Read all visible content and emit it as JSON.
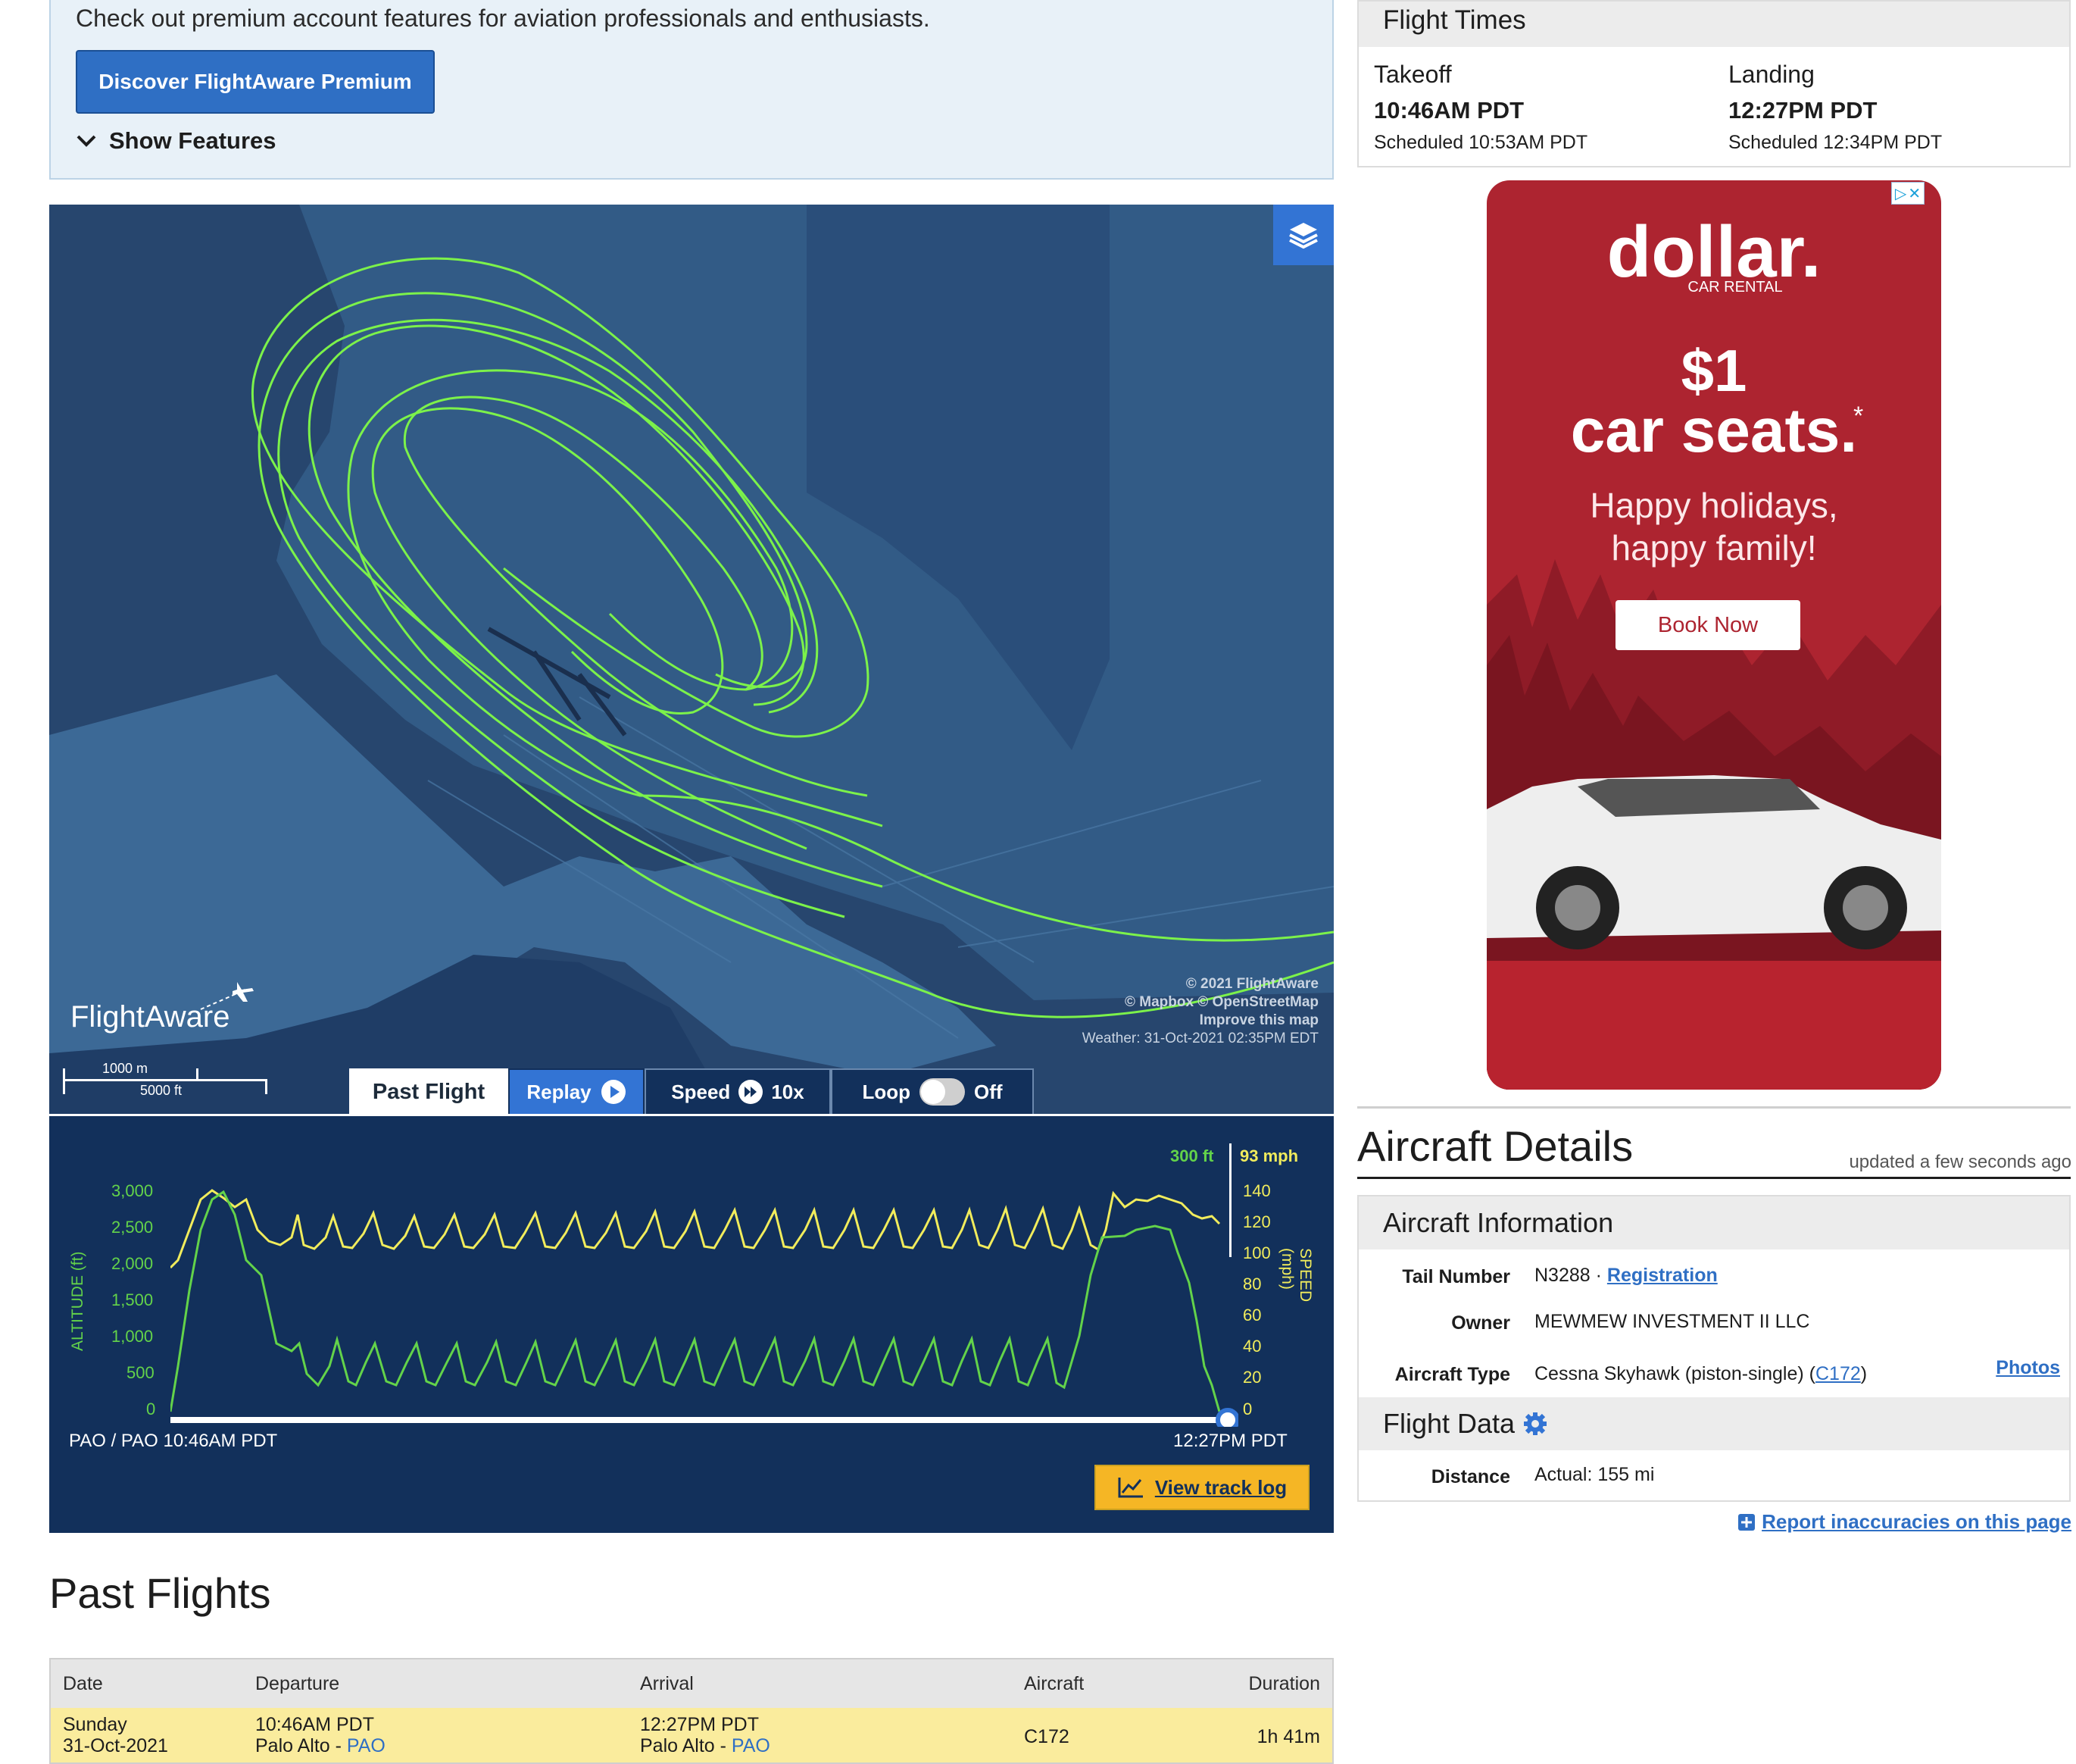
{
  "premium": {
    "text": "Check out premium account features for aviation professionals and enthusiasts.",
    "button": "Discover FlightAware Premium",
    "show_features": "Show Features"
  },
  "map": {
    "attribution": [
      "© 2021 FlightAware",
      "© Mapbox © OpenStreetMap",
      "Improve this map",
      "Weather: 31-Oct-2021 02:35PM EDT"
    ],
    "logo": "FlightAware",
    "scale_m": "1000 m",
    "scale_ft": "5000 ft",
    "tab_past_flight": "Past Flight",
    "replay": "Replay",
    "speed_label": "Speed",
    "speed_value": "10x",
    "loop_label": "Loop",
    "loop_state": "Off",
    "track_color": "#7cf24a"
  },
  "graph": {
    "alt_readout": "300 ft",
    "speed_readout": "93 mph",
    "alt_ticks": [
      "3,000",
      "2,500",
      "2,000",
      "1,500",
      "1,000",
      "500",
      "0"
    ],
    "speed_ticks": [
      "140",
      "120",
      "100",
      "80",
      "60",
      "40",
      "20",
      "0"
    ],
    "alt_axis_label": "ALTITUDE (ft)",
    "speed_axis_label": "SPEED (mph)",
    "start_label": "PAO / PAO 10:46AM PDT",
    "end_label": "12:27PM PDT",
    "track_log": "View track log",
    "alt_color": "#63d34a",
    "speed_color": "#f1ec5c"
  },
  "past_flights": {
    "title": "Past Flights",
    "headers": [
      "Date",
      "Departure",
      "Arrival",
      "Aircraft",
      "Duration"
    ],
    "row": {
      "date_line1": "Sunday",
      "date_line2": "31-Oct-2021",
      "dep_time": "10:46AM PDT",
      "dep_city": "Palo Alto - ",
      "dep_code": "PAO",
      "arr_time": "12:27PM PDT",
      "arr_city": "Palo Alto - ",
      "arr_code": "PAO",
      "aircraft": "C172",
      "duration": "1h 41m"
    }
  },
  "flight_times": {
    "title": "Flight Times",
    "takeoff_label": "Takeoff",
    "takeoff_time": "10:46AM PDT",
    "takeoff_sched": "Scheduled 10:53AM PDT",
    "landing_label": "Landing",
    "landing_time": "12:27PM PDT",
    "landing_sched": "Scheduled 12:34PM PDT"
  },
  "ad": {
    "brand": "dollar.",
    "brand_sub": "CAR RENTAL",
    "price": "$1",
    "headline": "car seats.",
    "asterisk": "*",
    "line1": "Happy holidays,",
    "line2": "happy family!",
    "cta": "Book Now"
  },
  "aircraft_details": {
    "title": "Aircraft Details",
    "updated": "updated a few seconds ago",
    "info_header": "Aircraft Information",
    "tail_label": "Tail Number",
    "tail_value": "N3288 · ",
    "registration": "Registration",
    "owner_label": "Owner",
    "owner_value": "MEWMEW INVESTMENT II LLC",
    "type_label": "Aircraft Type",
    "type_value": "Cessna Skyhawk (piston-single) (",
    "type_code": "C172",
    "type_close": ")",
    "photos": "Photos",
    "flight_data_header": "Flight Data",
    "distance_label": "Distance",
    "distance_value": "Actual: 155 mi",
    "report": "Report inaccuracies on this page"
  }
}
